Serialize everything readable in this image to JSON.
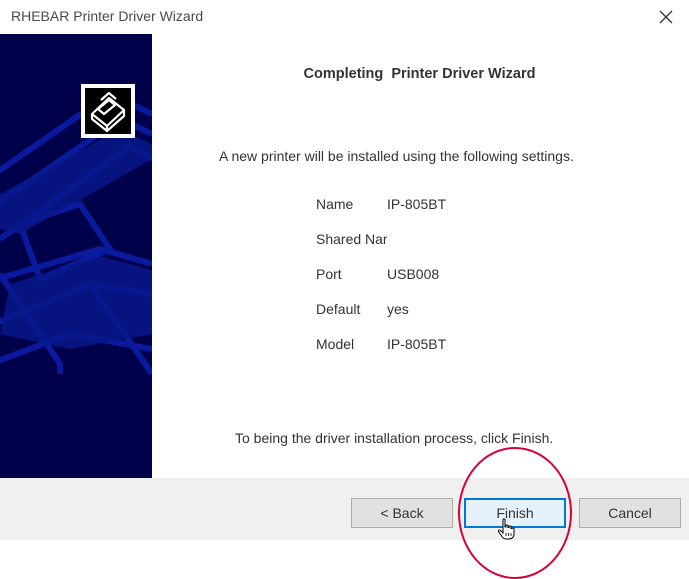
{
  "window": {
    "title": "RHEBAR Printer Driver Wizard",
    "close_icon": "close-icon"
  },
  "banner": {
    "logo_icon": "printer-logo-icon",
    "color": "#00004a"
  },
  "wizard": {
    "heading": "Completing  Printer Driver Wizard",
    "intro": "A new printer will be installed using the following settings.",
    "settings": [
      {
        "label": "Name",
        "value": "IP-805BT"
      },
      {
        "label": "Shared Name",
        "value": ""
      },
      {
        "label": "Port",
        "value": "USB008"
      },
      {
        "label": "Default",
        "value": "yes"
      },
      {
        "label": "Model",
        "value": "IP-805BT"
      }
    ],
    "footer": "To being the driver installation process, click Finish."
  },
  "buttons": {
    "back": "< Back",
    "finish": "Finish",
    "cancel": "Cancel"
  },
  "annotation": {
    "highlight_color": "#d6003c",
    "cursor_icon": "hand-pointer-icon"
  }
}
